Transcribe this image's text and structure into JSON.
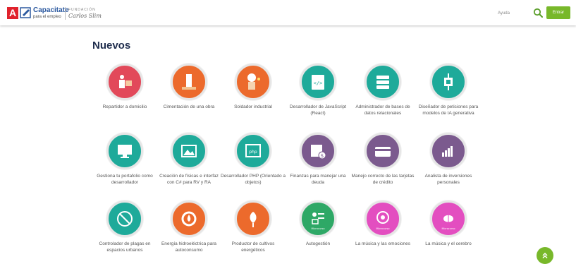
{
  "header": {
    "logo_letter": "A",
    "brand_title": "Capacitate",
    "brand_subtitle": "para el empleo",
    "foundation_label": "FUNDACIÓN",
    "foundation_name": "Carlos Slim",
    "help_label": "Ayuda",
    "login_label": "Entrar"
  },
  "section": {
    "title": "Nuevos"
  },
  "courses": [
    {
      "title": "Repartidor a domicilio",
      "color": "#e2495a",
      "icon": "delivery-person-icon"
    },
    {
      "title": "Cimentación de una obra",
      "color": "#ec6a2c",
      "icon": "building-foundation-icon"
    },
    {
      "title": "Soldador industrial",
      "color": "#ec6a2c",
      "icon": "welder-icon"
    },
    {
      "title": "Desarrollador de JavaScript (React)",
      "color": "#1eaa9a",
      "icon": "code-document-icon"
    },
    {
      "title": "Administrador de bases de datos relacionales",
      "color": "#1eaa9a",
      "icon": "database-server-icon"
    },
    {
      "title": "Diseñador de peticiones para modelos de IA generativa",
      "color": "#1eaa9a",
      "icon": "ai-chip-icon"
    },
    {
      "title": "Gestiona tu portafolio como desarrollador",
      "color": "#1eaa9a",
      "icon": "portfolio-screen-icon"
    },
    {
      "title": "Creación de físicas e interfaz con C# para RV y RA",
      "color": "#1eaa9a",
      "icon": "vr-image-icon"
    },
    {
      "title": "Desarrollador PHP (Orientado a objetos)",
      "color": "#1eaa9a",
      "icon": "php-window-icon"
    },
    {
      "title": "Finanzas para manejar una deuda",
      "color": "#7b5a8e",
      "icon": "calendar-money-icon"
    },
    {
      "title": "Manejo correcto de las tarjetas de crédito",
      "color": "#7b5a8e",
      "icon": "credit-card-icon"
    },
    {
      "title": "Analista de inversiones personales",
      "color": "#7b5a8e",
      "icon": "investment-chart-icon"
    },
    {
      "title": "Controlador de plagas en espacios urbanos",
      "color": "#1eaa9a",
      "icon": "pest-control-icon"
    },
    {
      "title": "Energía hidroeléctrica para autoconsumo",
      "color": "#ec6a2c",
      "icon": "hydro-energy-icon"
    },
    {
      "title": "Productor de cultivos energéticos",
      "color": "#ec6a2c",
      "icon": "plant-plug-icon"
    },
    {
      "title": "Autogestión",
      "color": "#2ea866",
      "icon": "self-management-icon",
      "badge": "Microcurso"
    },
    {
      "title": "La música y las emociones",
      "color": "#e34ec0",
      "icon": "music-head-icon",
      "badge": "Microcurso"
    },
    {
      "title": "La música y el cerebro",
      "color": "#e34ec0",
      "icon": "music-brain-icon",
      "badge": "Microcurso"
    }
  ]
}
